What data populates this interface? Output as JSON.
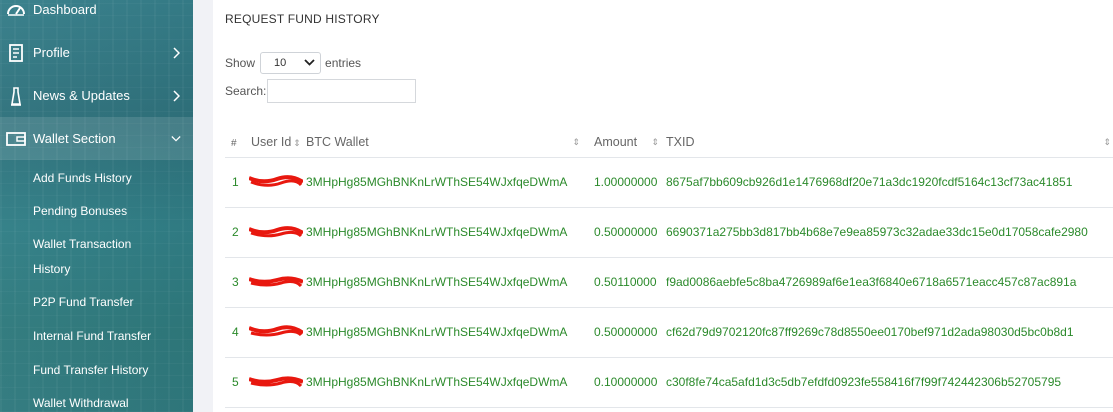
{
  "sidebar": {
    "items": [
      {
        "label": "Dashboard",
        "icon": "dashboard-icon"
      },
      {
        "label": "Profile",
        "icon": "profile-icon"
      },
      {
        "label": "News & Updates",
        "icon": "news-icon"
      },
      {
        "label": "Wallet Section",
        "icon": "wallet-icon"
      }
    ],
    "subitems": [
      "Add Funds History",
      "Pending Bonuses",
      "Wallet Transaction",
      "History",
      "P2P Fund Transfer",
      "Internal Fund Transfer",
      "Fund Transfer History",
      "Wallet Withdrawal"
    ]
  },
  "panel": {
    "title": "REQUEST FUND HISTORY",
    "show_label": "Show",
    "entries_value": "10",
    "entries_label": "entries",
    "search_label": "Search:",
    "search_value": ""
  },
  "table": {
    "headers": [
      "#",
      "User Id",
      "BTC Wallet",
      "Amount",
      "TXID"
    ],
    "rows": [
      {
        "num": "1",
        "wallet": "3MHpHg85MGhBNKnLrWThSE54WJxfqeDWmA",
        "amount": "1.00000000",
        "txid": "8675af7bb609cb926d1e1476968df20e71a3dc1920fcdf5164c13cf73ac41851"
      },
      {
        "num": "2",
        "wallet": "3MHpHg85MGhBNKnLrWThSE54WJxfqeDWmA",
        "amount": "0.50000000",
        "txid": "6690371a275bb3d817bb4b68e7e9ea85973c32adae33dc15e0d17058cafe2980"
      },
      {
        "num": "3",
        "wallet": "3MHpHg85MGhBNKnLrWThSE54WJxfqeDWmA",
        "amount": "0.50110000",
        "txid": "f9ad0086aebfe5c8ba4726989af6e1ea3f6840e6718a6571eacc457c87ac891a"
      },
      {
        "num": "4",
        "wallet": "3MHpHg85MGhBNKnLrWThSE54WJxfqeDWmA",
        "amount": "0.50000000",
        "txid": "cf62d79d9702120fc87ff9269c78d8550ee0170bef971d2ada98030d5bc0b8d1"
      },
      {
        "num": "5",
        "wallet": "3MHpHg85MGhBNKnLrWThSE54WJxfqeDWmA",
        "amount": "0.10000000",
        "txid": "c30f8fe74ca5afd1d3c5db7efdfd0923fe558416f7f99f742442306b52705795"
      }
    ]
  },
  "colors": {
    "link_green": "#2b8a2b",
    "redaction": "#e8180f",
    "sidebar": "#2f7a86"
  }
}
